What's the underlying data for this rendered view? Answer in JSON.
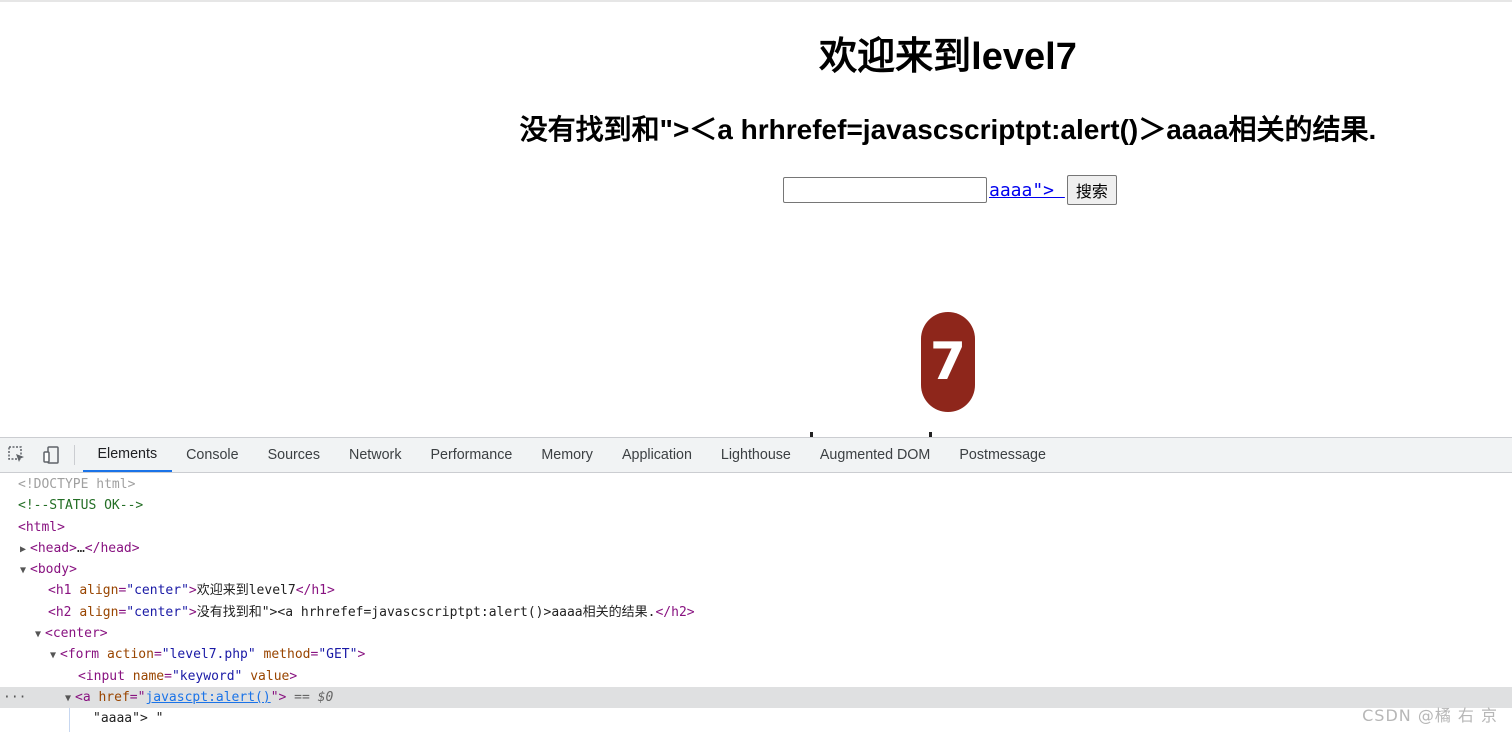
{
  "page": {
    "h1": "欢迎来到level7",
    "h2": "没有找到和\">＜a hrhrefef=javascscriptpt:alert()＞aaaa相关的结果.",
    "keyword_value": "",
    "injected_link_text": "aaaa\"> ",
    "search_button": "搜索",
    "logo_digit": "7"
  },
  "devtools": {
    "tabs": [
      "Elements",
      "Console",
      "Sources",
      "Network",
      "Performance",
      "Memory",
      "Application",
      "Lighthouse",
      "Augmented DOM",
      "Postmessage"
    ],
    "active_tab": "Elements",
    "dom": {
      "doctype": "<!DOCTYPE html>",
      "comment": "<!--STATUS OK-->",
      "html_open": "<html>",
      "head": "<head>",
      "head_ellipsis": "…",
      "head_close": "</head>",
      "body_open": "<body>",
      "h1_open": "<h1",
      "h1_attr_name": "align",
      "h1_attr_value": "\"center\"",
      "h1_text": "欢迎来到level7",
      "h1_close": "</h1>",
      "h2_open": "<h2",
      "h2_attr_name": "align",
      "h2_attr_value": "\"center\"",
      "h2_text": "没有找到和\"><a hrhrefef=javascscriptpt:alert()>aaaa相关的结果.",
      "h2_close": "</h2>",
      "center_open": "<center>",
      "form_open": "<form",
      "form_action_name": "action",
      "form_action_value": "\"level7.php\"",
      "form_method_name": "method",
      "form_method_value": "\"GET\"",
      "input_open": "<input",
      "input_name_attr": "name",
      "input_name_value": "\"keyword\"",
      "input_value_attr": "value",
      "a_open": "<a",
      "a_href_attr": "href",
      "a_href_value": "javascpt:alert()",
      "selected_marker": "== $0",
      "text_node": "\"aaaa\"> \""
    }
  },
  "watermark": "CSDN @橘 右 京",
  "colors": {
    "logo_bg": "#8e261b",
    "link": "#0000ee",
    "devtools_active": "#1a73e8",
    "tag": "#881280",
    "attr_name": "#994500",
    "attr_value": "#1a1aa6",
    "comment": "#236e25"
  }
}
